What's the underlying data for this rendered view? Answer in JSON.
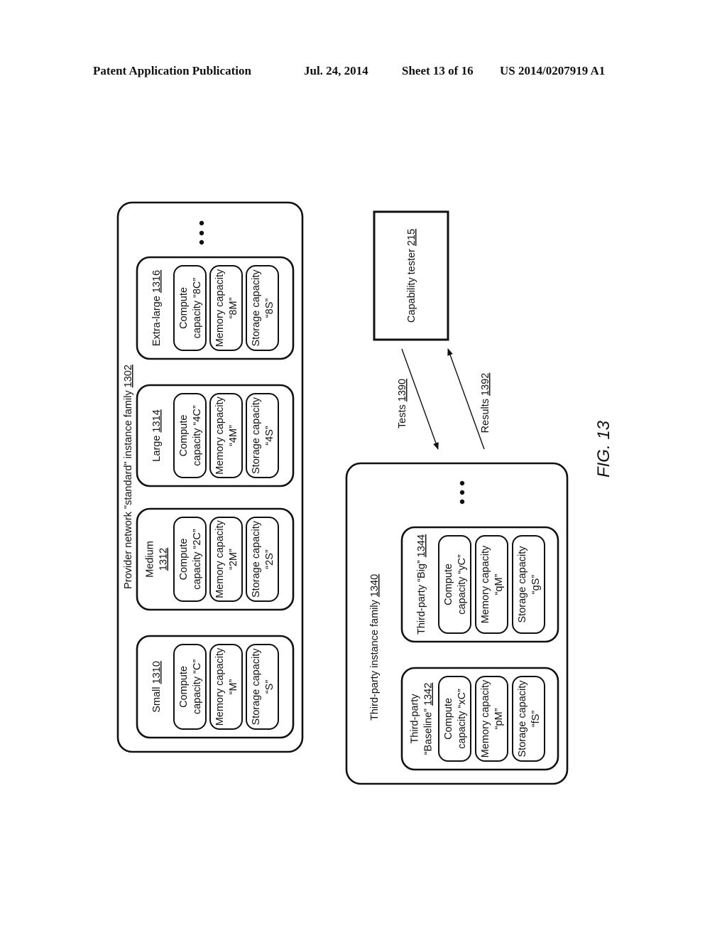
{
  "header": {
    "publication": "Patent Application Publication",
    "date": "Jul. 24, 2014",
    "sheet": "Sheet 13 of 16",
    "number": "US 2014/0207919 A1"
  },
  "figure_label": "FIG. 13",
  "provider_family": {
    "title": "Provider network \"standard\" instance family",
    "ref": "1302",
    "more_indicator": "...",
    "instances": [
      {
        "name_lines": [
          "Small"
        ],
        "ref": "1310",
        "compute": [
          "Compute",
          "capacity “C”"
        ],
        "memory": [
          "Memory capacity",
          "“M”"
        ],
        "storage": [
          "Storage capacity",
          "“S”"
        ]
      },
      {
        "name_lines": [
          "Medium"
        ],
        "ref": "1312",
        "compute": [
          "Compute",
          "capacity “2C”"
        ],
        "memory": [
          "Memory capacity",
          "“2M”"
        ],
        "storage": [
          "Storage capacity",
          "“2S”"
        ]
      },
      {
        "name_lines": [
          "Large"
        ],
        "ref": "1314",
        "compute": [
          "Compute",
          "capacity “4C”"
        ],
        "memory": [
          "Memory capacity",
          "“4M”"
        ],
        "storage": [
          "Storage capacity",
          "“4S”"
        ]
      },
      {
        "name_lines": [
          "Extra-large"
        ],
        "ref": "1316",
        "compute": [
          "Compute",
          "capacity “8C”"
        ],
        "memory": [
          "Memory capacity",
          "“8M”"
        ],
        "storage": [
          "Storage capacity",
          "“8S”"
        ]
      }
    ]
  },
  "third_party_family": {
    "title": "Third-party instance family",
    "ref": "1340",
    "more_indicator": "...",
    "instances": [
      {
        "name_lines": [
          "Third-party",
          "“Baseline”"
        ],
        "ref": "1342",
        "compute": [
          "Compute",
          "capacity “xC”"
        ],
        "memory": [
          "Memory capacity",
          "“pM”"
        ],
        "storage": [
          "Storage capacity",
          "“fS”"
        ]
      },
      {
        "name_lines": [
          "Third-party “Big”"
        ],
        "ref": "1344",
        "compute": [
          "Compute",
          "capacity “yC”"
        ],
        "memory": [
          "Memory capacity",
          "“qM”"
        ],
        "storage": [
          "Storage capacity",
          "“gS”"
        ]
      }
    ]
  },
  "capability_tester": {
    "label": "Capability tester",
    "ref": "215"
  },
  "flows": {
    "tests": {
      "label": "Tests",
      "ref": "1390"
    },
    "results": {
      "label": "Results",
      "ref": "1392"
    }
  }
}
